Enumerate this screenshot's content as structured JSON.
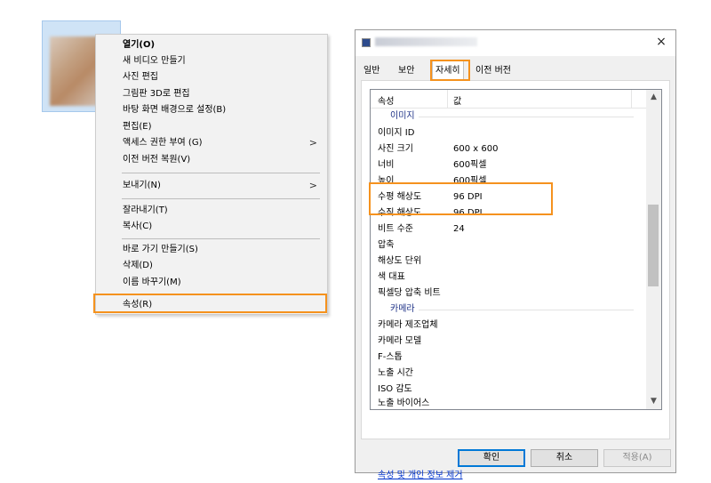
{
  "context_menu": {
    "items": [
      {
        "label": "열기(O)"
      },
      {
        "label": "새 비디오 만들기"
      },
      {
        "label": "사진 편집"
      },
      {
        "label": "그림판 3D로 편집"
      },
      {
        "label": "바탕 화면 배경으로 설정(B)"
      },
      {
        "label": "편집(E)"
      },
      {
        "label": "액세스 권한 부여 (G)"
      },
      {
        "label": "이전 버전 복원(V)"
      },
      {
        "label": "보내기(N)"
      },
      {
        "label": "잘라내기(T)"
      },
      {
        "label": "복사(C)"
      },
      {
        "label": "바로 가기 만들기(S)"
      },
      {
        "label": "삭제(D)"
      },
      {
        "label": "이름 바꾸기(M)"
      },
      {
        "label": "속성(R)"
      }
    ],
    "submenu_arrow": ">"
  },
  "dialog": {
    "close": "×",
    "tabs": [
      {
        "label": "일반"
      },
      {
        "label": "보안"
      },
      {
        "label": "자세히"
      },
      {
        "label": "이전 버전"
      }
    ],
    "header": {
      "name": "속성",
      "value": "값"
    },
    "groups": {
      "image": "이미지",
      "camera": "카메라"
    },
    "rows": [
      {
        "name": "이미지 ID",
        "value": ""
      },
      {
        "name": "사진 크기",
        "value": "600 x 600"
      },
      {
        "name": "너비",
        "value": "600픽셀"
      },
      {
        "name": "높이",
        "value": "600픽셀"
      },
      {
        "name": "수평 해상도",
        "value": "96 DPI"
      },
      {
        "name": "수직 해상도",
        "value": "96 DPI"
      },
      {
        "name": "비트 수준",
        "value": "24"
      },
      {
        "name": "압축",
        "value": ""
      },
      {
        "name": "해상도 단위",
        "value": ""
      },
      {
        "name": "색 대표",
        "value": ""
      },
      {
        "name": "픽셀당 압축 비트",
        "value": ""
      },
      {
        "name": "카메라 제조업체",
        "value": ""
      },
      {
        "name": "카메라 모델",
        "value": ""
      },
      {
        "name": "F-스톱",
        "value": ""
      },
      {
        "name": "노출 시간",
        "value": ""
      },
      {
        "name": "ISO 감도",
        "value": ""
      },
      {
        "name": "노출 바이어스",
        "value": ""
      }
    ],
    "remove_link": "속성 및 개인 정보 제거",
    "buttons": {
      "ok": "확인",
      "cancel": "취소",
      "apply": "적용(A)"
    }
  },
  "colors": {
    "highlight": "#f5921e",
    "group_text": "#1e3287",
    "link": "#0033cc",
    "default_button_border": "#0078d7"
  }
}
